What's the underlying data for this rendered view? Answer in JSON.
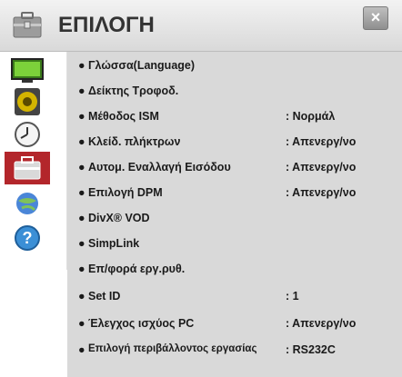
{
  "header": {
    "title": "ΕΠΙΛΟΓΗ",
    "close_symbol": "×"
  },
  "sidebar": {
    "items": [
      {
        "icon": "tv-screen-icon"
      },
      {
        "icon": "speaker-icon"
      },
      {
        "icon": "clock-icon"
      },
      {
        "icon": "toolbox-icon",
        "active": true
      },
      {
        "icon": "network-globe-icon"
      },
      {
        "icon": "help-icon"
      }
    ]
  },
  "menu": {
    "items": [
      {
        "bullet": "●",
        "label": "Γλώσσα(Language)",
        "value": ""
      },
      {
        "bullet": "●",
        "label": "Δείκτης Τροφοδ.",
        "value": ""
      },
      {
        "bullet": "●",
        "label": "Μέθοδος ISM",
        "value": ": Νορμάλ"
      },
      {
        "bullet": "●",
        "label": "Κλείδ. πλήκτρων",
        "value": ": Απενεργ/νο"
      },
      {
        "bullet": "●",
        "label": "Αυτομ. Εναλλαγή Εισόδου",
        "value": ": Απενεργ/νο"
      },
      {
        "bullet": "●",
        "label": "Επιλογή DPM",
        "value": ": Απενεργ/νο"
      },
      {
        "bullet": "●",
        "label": "DivX® VOD",
        "value": ""
      },
      {
        "bullet": "●",
        "label": "SimpLink",
        "value": ""
      },
      {
        "bullet": "●",
        "label": "Επ/φορά εργ.ρυθ.",
        "value": ""
      },
      {
        "bullet": "●",
        "label": "Set ID",
        "value": ": 1"
      },
      {
        "bullet": "●",
        "label": "Έλεγχος ισχύος PC",
        "value": ": Απενεργ/νο"
      },
      {
        "bullet": "●",
        "label": "Επιλογή περιβάλλοντος εργασίας",
        "value": ": RS232C"
      }
    ]
  },
  "colors": {
    "accent": "#b3262b",
    "content_bg": "#d9d9d9"
  }
}
